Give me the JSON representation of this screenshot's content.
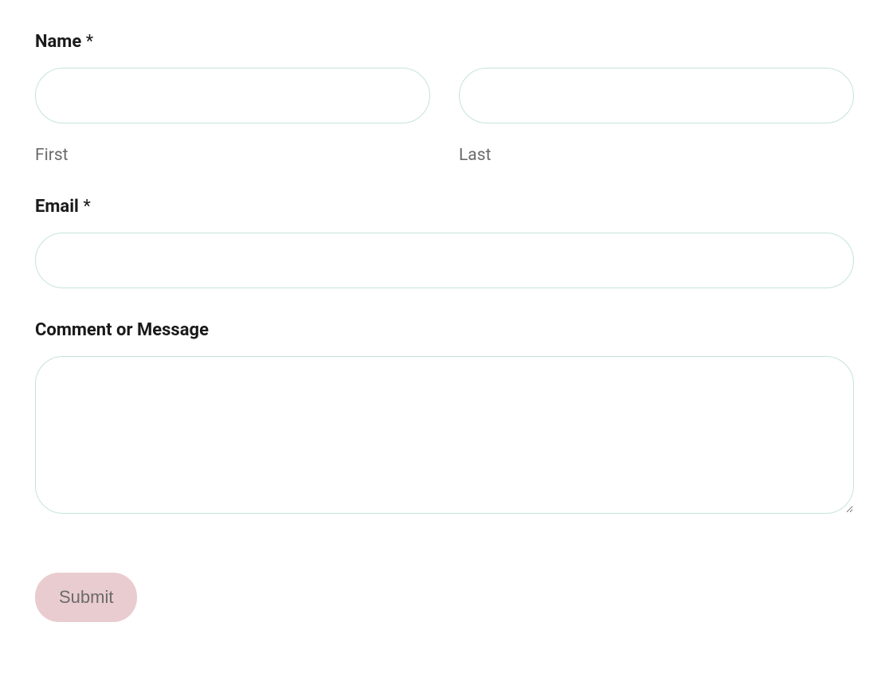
{
  "form": {
    "name": {
      "label": "Name",
      "required_mark": "*",
      "first": {
        "sublabel": "First",
        "value": ""
      },
      "last": {
        "sublabel": "Last",
        "value": ""
      }
    },
    "email": {
      "label": "Email",
      "required_mark": "*",
      "value": ""
    },
    "message": {
      "label": "Comment or Message",
      "value": ""
    },
    "submit": {
      "label": "Submit"
    }
  }
}
